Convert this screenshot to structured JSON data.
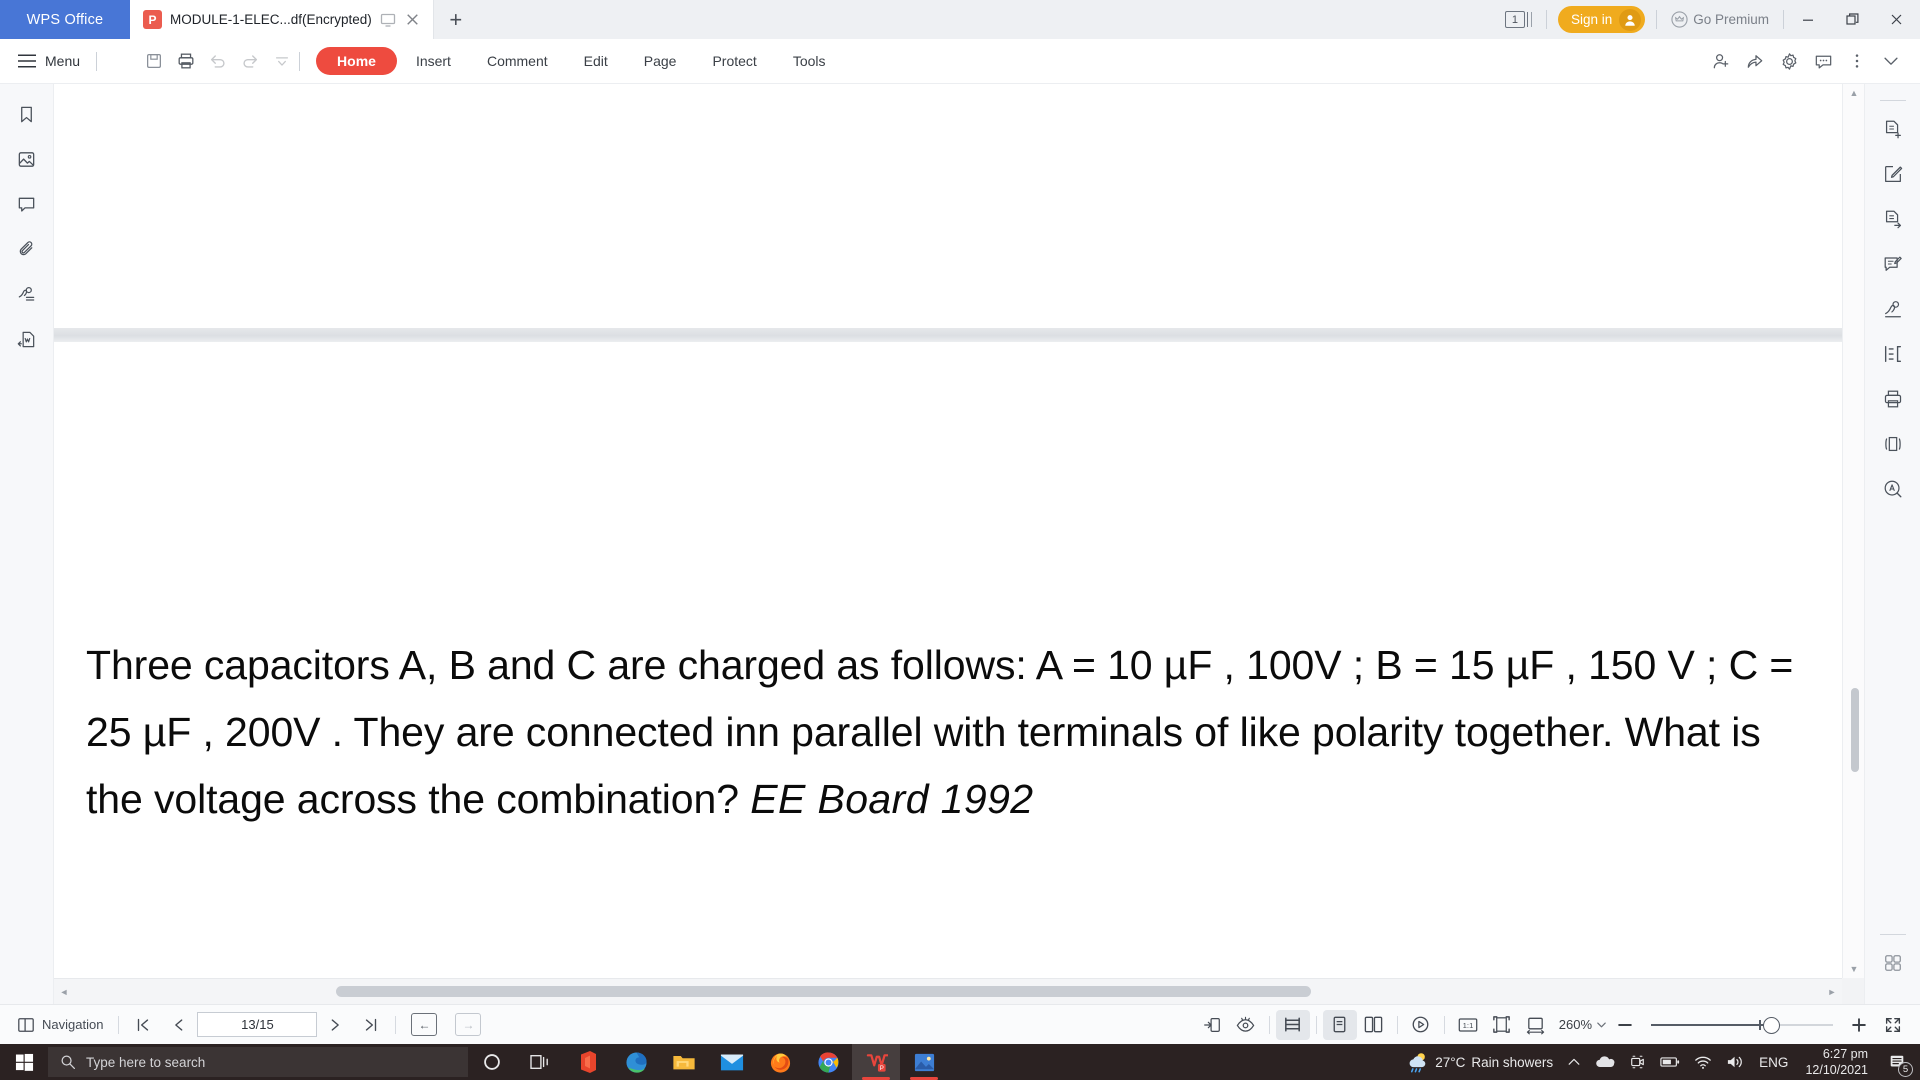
{
  "titlebar": {
    "brand": "WPS Office",
    "tab_title": "MODULE-1-ELEC...df(Encrypted)",
    "tab_icon_letter": "P",
    "new_tab": "+",
    "window_count": "1",
    "signin_label": "Sign in",
    "go_premium_label": "Go Premium",
    "minimize": "—",
    "restore": "❐",
    "close": "✕"
  },
  "ribbon": {
    "menu_label": "Menu",
    "quick_icons": [
      "open-folder-icon",
      "save-icon",
      "print-icon",
      "undo-icon",
      "redo-icon",
      "customize-dropdown-icon"
    ],
    "tabs": [
      {
        "label": "Home",
        "active": true
      },
      {
        "label": "Insert",
        "active": false
      },
      {
        "label": "Comment",
        "active": false
      },
      {
        "label": "Edit",
        "active": false
      },
      {
        "label": "Page",
        "active": false
      },
      {
        "label": "Protect",
        "active": false
      },
      {
        "label": "Tools",
        "active": false
      }
    ],
    "right_icons": [
      "add-person-icon",
      "share-icon",
      "gear-icon",
      "comment-icon",
      "more-vertical-icon",
      "collapse-chevron-icon"
    ]
  },
  "left_rail": {
    "items": [
      "bookmark-icon",
      "thumbnail-icon",
      "comment-icon",
      "attachment-icon",
      "signature-icon",
      "export-doc-icon"
    ]
  },
  "right_rail": {
    "items": [
      "pdf-to-word-icon",
      "edit-pdf-icon",
      "pdf-export-icon",
      "annotate-icon",
      "sign-pdf-icon",
      "merge-split-icon",
      "print-icon",
      "compress-icon",
      "ocr-icon"
    ],
    "bottom": "apps-grid-icon"
  },
  "document": {
    "text_part1": "Three capacitors A, B and C are charged as follows: A = 10 µF , 100V  ; B = 15 µF , 150 V  ; C = 25 µF , 200V . They are connected inn parallel with terminals of like polarity together. What is the voltage across the combination? ",
    "text_italic": "EE Board 1992"
  },
  "statusbar": {
    "navigation_label": "Navigation",
    "first_page_icon": "first-page-icon",
    "prev_page_icon": "prev-page-icon",
    "page_value": "13/15",
    "next_page_icon": "next-page-icon",
    "last_page_icon": "last-page-icon",
    "back_icon": "←",
    "forward_icon": "→",
    "view_icons": [
      "fit-page-icon",
      "read-mode-icon",
      "page-fit-icon",
      "single-page-icon",
      "two-page-icon",
      "play-icon",
      "actual-size-icon",
      "fit-page-box-icon",
      "fit-width-icon"
    ],
    "actual_size_label": "1:1",
    "zoom_level": "260%",
    "zoom_out": "−",
    "zoom_in": "+",
    "fullscreen_icon": "fullscreen-icon"
  },
  "taskbar": {
    "search_placeholder": "Type here to search",
    "apps": [
      {
        "name": "cortana-icon"
      },
      {
        "name": "task-view-icon"
      },
      {
        "name": "office-icon"
      },
      {
        "name": "edge-icon"
      },
      {
        "name": "file-explorer-icon"
      },
      {
        "name": "mail-icon"
      },
      {
        "name": "firefox-icon"
      },
      {
        "name": "chrome-icon"
      },
      {
        "name": "wps-office-icon"
      },
      {
        "name": "photos-icon"
      }
    ],
    "weather_temp": "27°C",
    "weather_desc": "Rain showers",
    "language": "ENG",
    "time": "6:27 pm",
    "date": "12/10/2021",
    "notification_count": "5"
  },
  "colors": {
    "brand_blue": "#4876d6",
    "accent_red": "#ee4b3f",
    "premium_yellow": "#f0ab1e",
    "taskbar_bg": "#2b2222"
  }
}
